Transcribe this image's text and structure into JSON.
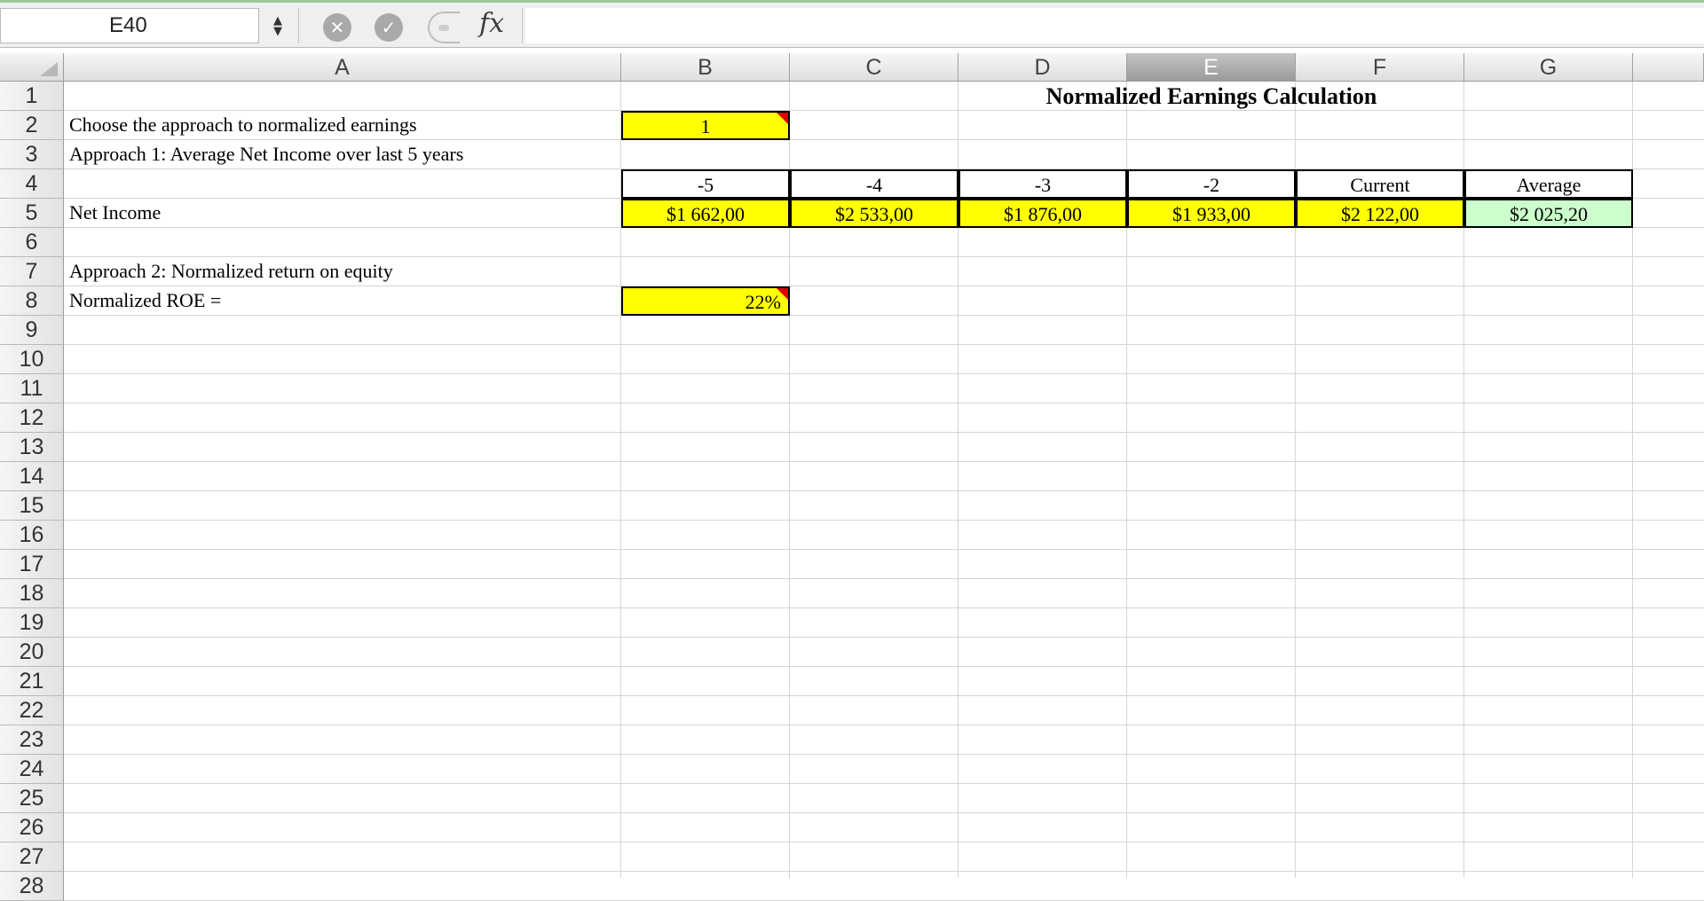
{
  "formula_bar": {
    "name_box": "E40",
    "stepper_glyph": "▲▼",
    "cancel_glyph": "✕",
    "enter_glyph": "✓",
    "fx_label": "fx",
    "formula": ""
  },
  "columns": [
    "A",
    "B",
    "C",
    "D",
    "E",
    "F",
    "G"
  ],
  "selected_column": "E",
  "rows": [
    "1",
    "2",
    "3",
    "4",
    "5",
    "6",
    "7",
    "8",
    "9",
    "10",
    "11",
    "12",
    "13",
    "14",
    "15",
    "16",
    "17",
    "18",
    "19",
    "20",
    "21",
    "22",
    "23",
    "24",
    "25",
    "26",
    "27",
    "28"
  ],
  "sheet": {
    "title": "Normalized Earnings Calculation",
    "choose_label": "Choose the approach to normalized earnings",
    "choose_value": "1",
    "approach1_label": "Approach 1: Average Net Income over last 5 years",
    "year_headers": [
      "-5",
      "-4",
      "-3",
      "-2",
      "Current",
      "Average"
    ],
    "net_income_label": "Net Income",
    "net_income_values": [
      "$1 662,00",
      "$2 533,00",
      "$1 876,00",
      "$1 933,00",
      "$2 122,00",
      "$2 025,20"
    ],
    "approach2_label": "Approach 2: Normalized return on equity",
    "roe_label": "Normalized ROE =",
    "roe_value": "22%"
  },
  "colors": {
    "input_fill": "#ffff00",
    "average_fill": "#ccffcc",
    "comment_flag": "#e00000",
    "selected_column_header": "#a8a8a8"
  },
  "icons": {
    "name_box_stepper": "stepper-icon",
    "cancel": "cancel-icon",
    "enter": "enter-icon",
    "insert_function": "fx-icon"
  }
}
